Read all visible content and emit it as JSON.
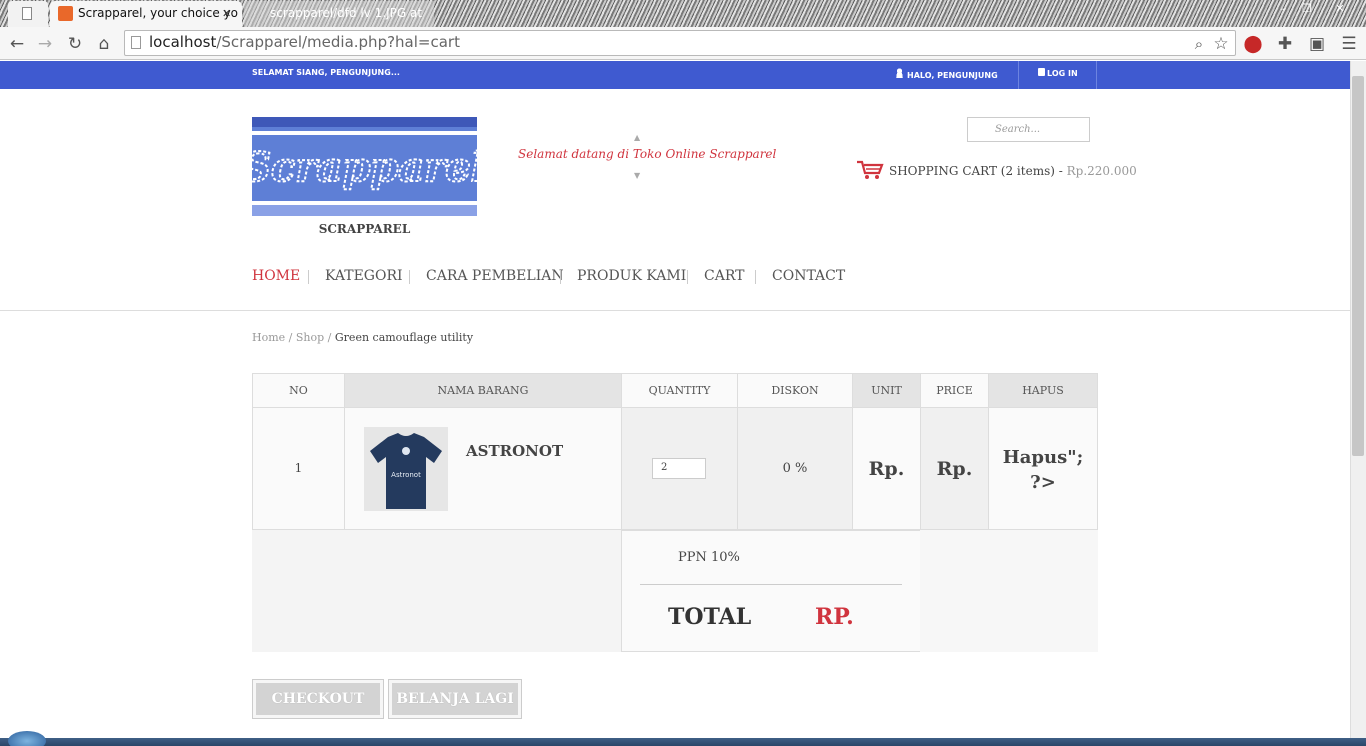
{
  "browser": {
    "tabs": [
      {
        "label": ""
      },
      {
        "label": "Scrapparel, your choice yo",
        "close": "✕"
      },
      {
        "label": "scrapparel/dfd lv 1.JPG at"
      }
    ],
    "url_host": "localhost",
    "url_path": "/Scrapparel/media.php?hal=cart"
  },
  "topbar": {
    "greeting": "SELAMAT SIANG, PENGUNJUNG...",
    "halo": "HALO,  PENGUNJUNG",
    "login": "LOG IN"
  },
  "header": {
    "logo_text": "Scrapparel",
    "site_name": "SCRAPPAREL",
    "marquee": "Selamat datang di Toko Online Scrapparel",
    "search_placeholder": "Search...",
    "cart_label": "SHOPPING CART (2 items) - ",
    "cart_amount": "Rp.220.000"
  },
  "nav": [
    "HOME",
    "KATEGORI",
    "CARA PEMBELIAN",
    "PRODUK KAMI",
    "CART",
    "CONTACT"
  ],
  "breadcrumb": {
    "home": "Home",
    "shop": "Shop",
    "current": "Green camouflage utility",
    "sep": "/"
  },
  "table": {
    "headers": [
      "NO",
      "NAMA BARANG",
      "QUANTITY",
      "DISKON",
      "UNIT PRICE",
      "PRICE",
      "HAPUS"
    ],
    "rows": [
      {
        "no": "1",
        "name": "ASTRONOT",
        "image_text": "Astronot",
        "quantity": "2",
        "diskon": "0 %",
        "unit_price": "Rp.",
        "price": "Rp.",
        "hapus": "Hapus\"; ?>"
      }
    ]
  },
  "summary": {
    "ppn": "PPN 10%",
    "total_label": "TOTAL",
    "total_value": "RP."
  },
  "buttons": {
    "checkout": "CHECKOUT",
    "belanja": "BELANJA LAGI"
  },
  "colors": {
    "brand_blue": "#3f5ad0",
    "accent_red": "#d0343e"
  }
}
